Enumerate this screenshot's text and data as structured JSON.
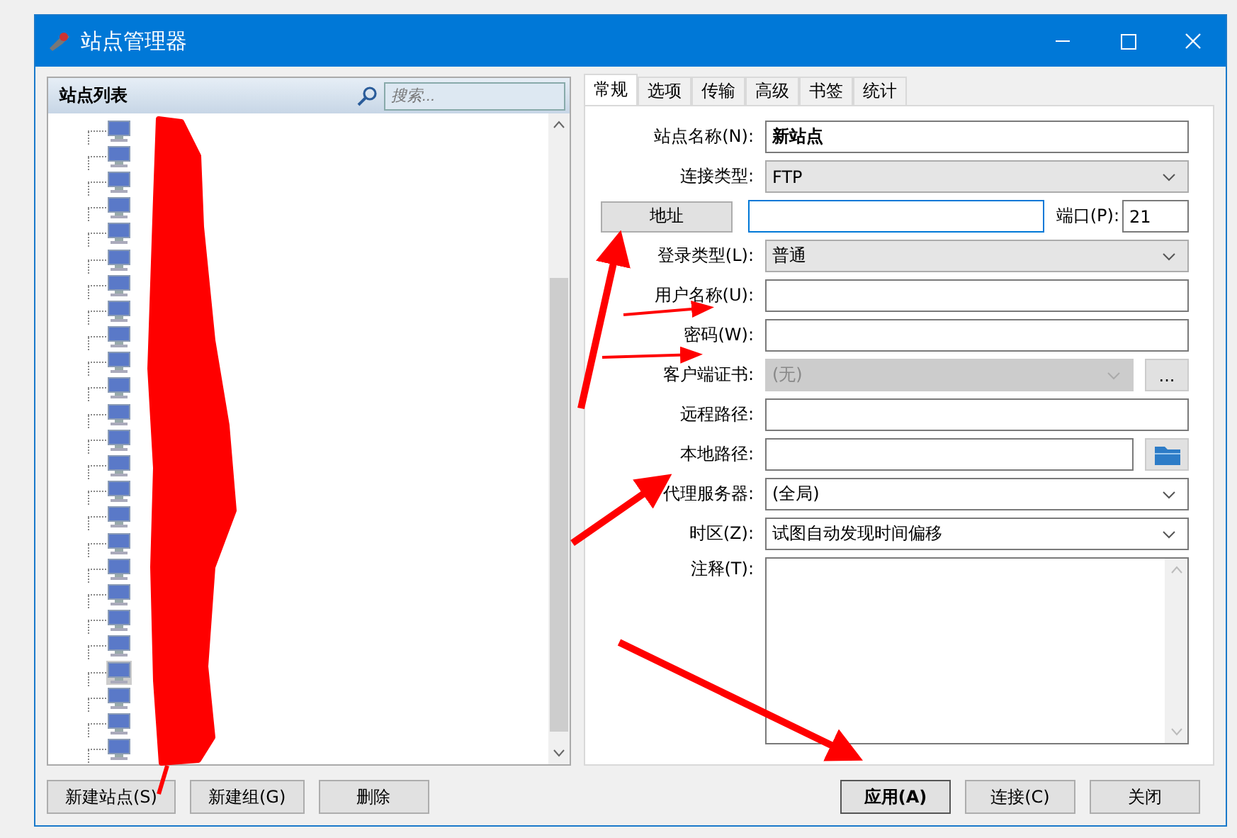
{
  "window": {
    "title": "站点管理器"
  },
  "site_list": {
    "title": "站点列表",
    "search": {
      "placeholder": "搜索..."
    },
    "items": [
      {
        "selected": false
      },
      {
        "selected": false
      },
      {
        "selected": false
      },
      {
        "selected": false
      },
      {
        "selected": false
      },
      {
        "selected": false
      },
      {
        "selected": false
      },
      {
        "selected": false
      },
      {
        "selected": false
      },
      {
        "selected": false
      },
      {
        "selected": false
      },
      {
        "selected": false
      },
      {
        "selected": false
      },
      {
        "selected": false
      },
      {
        "selected": false
      },
      {
        "selected": false
      },
      {
        "selected": false
      },
      {
        "selected": false
      },
      {
        "selected": false
      },
      {
        "selected": false
      },
      {
        "selected": false
      },
      {
        "selected": true
      },
      {
        "selected": false
      },
      {
        "selected": false
      },
      {
        "selected": false
      }
    ],
    "buttons": [
      "新建站点(S)",
      "新建组(G)",
      "删除"
    ]
  },
  "tabs": [
    {
      "label": "常规",
      "selected": true
    },
    {
      "label": "选项",
      "selected": false
    },
    {
      "label": "传输",
      "selected": false
    },
    {
      "label": "高级",
      "selected": false
    },
    {
      "label": "书签",
      "selected": false
    },
    {
      "label": "统计",
      "selected": false
    }
  ],
  "fields": [
    {
      "kind": "text",
      "label": "站点名称(N):",
      "value": "新站点",
      "bold": true
    },
    {
      "kind": "select",
      "label": "连接类型:",
      "value": "FTP"
    },
    {
      "kind": "address",
      "button": "地址",
      "port_label": "端口(P):",
      "port": "21"
    },
    {
      "kind": "select",
      "label": "登录类型(L):",
      "value": "普通"
    },
    {
      "kind": "text",
      "label": "用户名称(U):"
    },
    {
      "kind": "text",
      "label": "密码(W):"
    },
    {
      "kind": "select",
      "label": "客户端证书:",
      "value": "(无)",
      "disabled": true,
      "extra": "..."
    },
    {
      "kind": "text",
      "label": "远程路径:"
    },
    {
      "kind": "folder",
      "label": "本地路径:"
    },
    {
      "kind": "select",
      "label": "代理服务器:",
      "value": "(全局)"
    },
    {
      "kind": "select",
      "label": "时区(Z):",
      "value": "试图自动发现时间偏移"
    },
    {
      "kind": "textarea",
      "label": "注释(T):"
    }
  ],
  "buttons": [
    {
      "label": "应用(A)",
      "default": true
    },
    {
      "label": "连接(C)",
      "default": false
    },
    {
      "label": "关闭",
      "default": false
    }
  ]
}
